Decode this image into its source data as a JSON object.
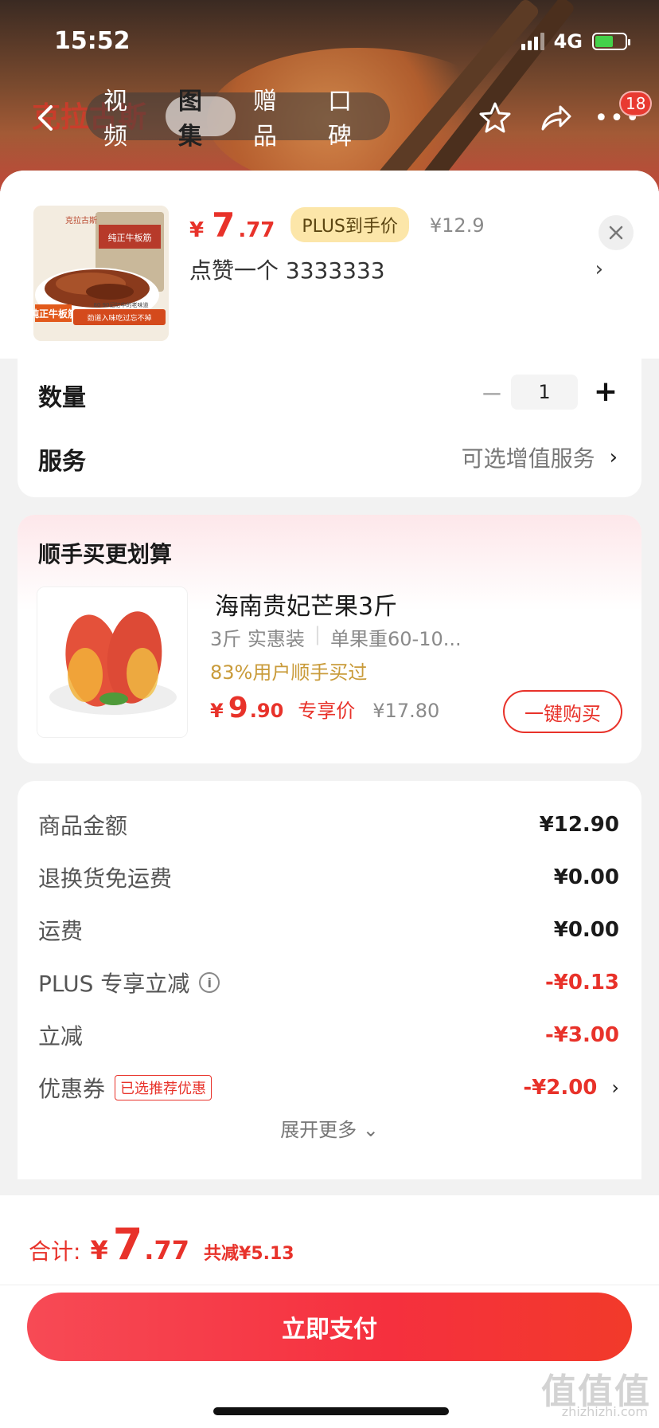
{
  "status_bar": {
    "time": "15:52",
    "network": "4G"
  },
  "header": {
    "brand": "克拉古斯",
    "tabs": [
      {
        "label": "视频"
      },
      {
        "label": "图集"
      },
      {
        "label": "赠品"
      },
      {
        "label": "口碑"
      }
    ],
    "active_tab": "图集",
    "badge_count": "18"
  },
  "product": {
    "price_currency": "¥",
    "price_integer": "7",
    "price_decimal": ".77",
    "plus_badge": "PLUS到手价",
    "original_price": "¥12.9",
    "selected_spec": "点赞一个  3333333",
    "thumb_text": {
      "brand": "克拉古斯",
      "tag": "纯正牛板筋",
      "slogan": "劲道入味吃过忘不掉",
      "sub": "80 90记忆中的老味道",
      "pack": "纯正牛板筋"
    }
  },
  "quantity": {
    "label": "数量",
    "minus": "−",
    "value": "1",
    "plus": "+"
  },
  "service": {
    "label": "服务",
    "value": "可选增值服务"
  },
  "bundle": {
    "title": "顺手买更划算",
    "item_name": "海南贵妃芒果3斤",
    "spec_1": "3斤 实惠装",
    "spec_2": "单果重60-10...",
    "social_proof": "83%用户顺手买过",
    "price_currency": "¥",
    "price_integer": "9",
    "price_decimal": ".90",
    "price_tag": "专享价",
    "original_price": "¥17.80",
    "buy_button": "一键购买"
  },
  "amounts": [
    {
      "label": "商品金额",
      "value": "¥12.90"
    },
    {
      "label": "退换货免运费",
      "value": "¥0.00"
    },
    {
      "label": "运费",
      "value": "¥0.00"
    },
    {
      "label": "PLUS 专享立减",
      "value": "-¥0.13"
    },
    {
      "label": "立减",
      "value": "-¥3.00"
    },
    {
      "label": "优惠券",
      "tag": "已选推荐优惠",
      "value": "-¥2.00"
    }
  ],
  "expand_more": "展开更多 ⌄",
  "footer": {
    "total_label": "合计:",
    "total_currency": "¥",
    "total_integer": "7",
    "total_decimal": ".77",
    "saved": "共减¥5.13",
    "pay_button": "立即支付"
  },
  "watermark": {
    "main": "值值值",
    "sub": "zhizhizhi.com"
  },
  "colors": {
    "accent_red": "#e8322a",
    "plus_gold": "#fce6a9",
    "social_gold": "#c99b3a"
  }
}
